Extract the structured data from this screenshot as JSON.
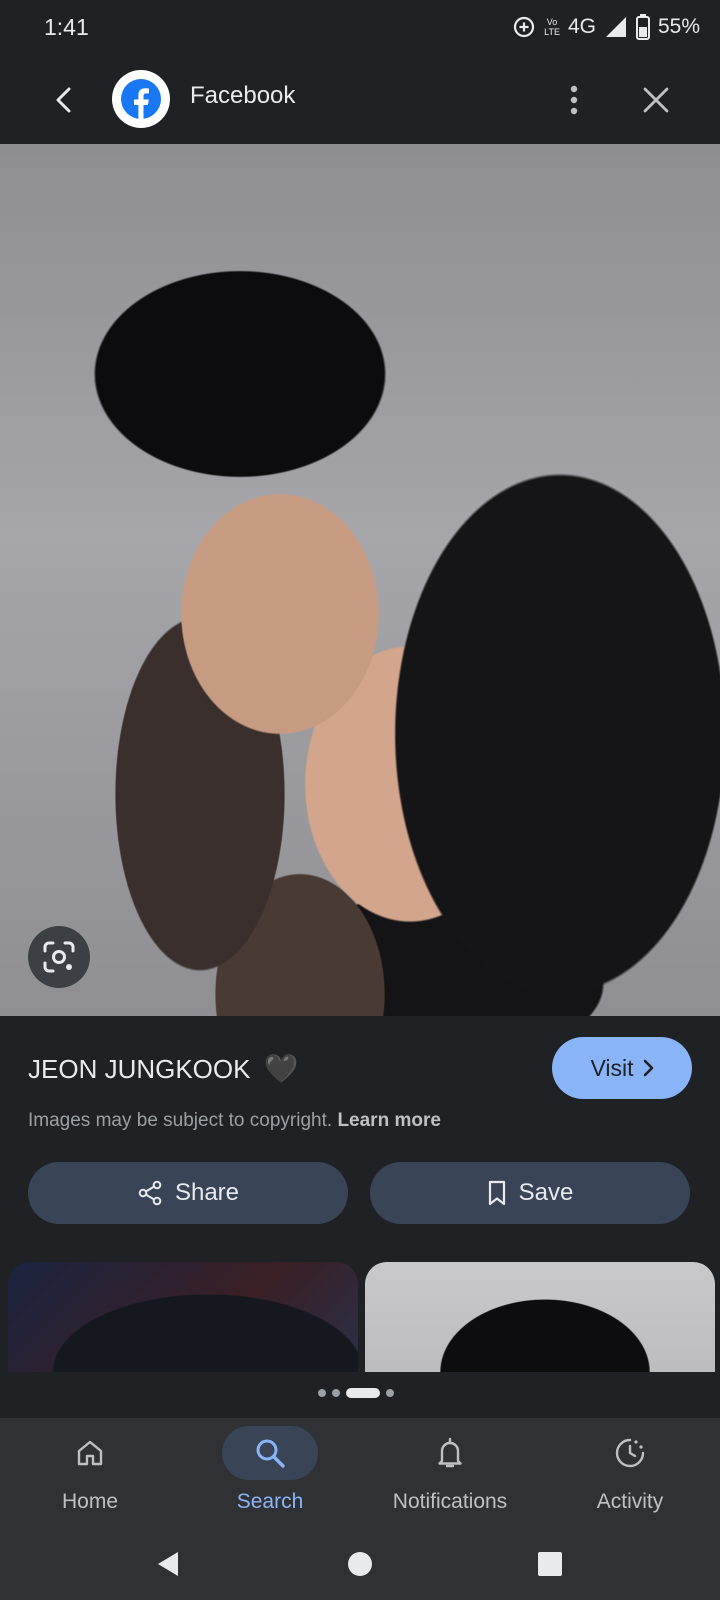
{
  "status_bar": {
    "time": "1:41",
    "volte_top": "Vo",
    "volte_bottom": "LTE",
    "network": "4G",
    "battery": "55%",
    "icons": [
      "data-saver-icon",
      "signal-icon",
      "battery-icon"
    ]
  },
  "app_bar": {
    "source_name": "Facebook",
    "icons": [
      "back-arrow-icon",
      "facebook-logo-icon",
      "more-vert-icon",
      "close-icon"
    ]
  },
  "image": {
    "lens_icon": "google-lens-icon"
  },
  "info": {
    "title": "JEON JUNGKOOK",
    "title_emoji": "🖤",
    "visit_label": "Visit",
    "copyright_text": "Images may be subject to copyright.",
    "learn_more": "Learn more"
  },
  "actions": {
    "share_label": "Share",
    "save_label": "Save"
  },
  "pager": {
    "count": 4,
    "active_index": 2
  },
  "bottom_nav": {
    "items": [
      {
        "label": "Home",
        "icon": "home-icon"
      },
      {
        "label": "Search",
        "icon": "search-icon",
        "active": true
      },
      {
        "label": "Notifications",
        "icon": "bell-icon"
      },
      {
        "label": "Activity",
        "icon": "activity-icon"
      }
    ]
  },
  "system_nav": {
    "icons": [
      "system-back-icon",
      "system-home-icon",
      "system-recents-icon"
    ]
  },
  "colors": {
    "background": "#202124",
    "accent": "#8ab4f8",
    "pill": "#394457",
    "nav_bar": "#303134"
  }
}
